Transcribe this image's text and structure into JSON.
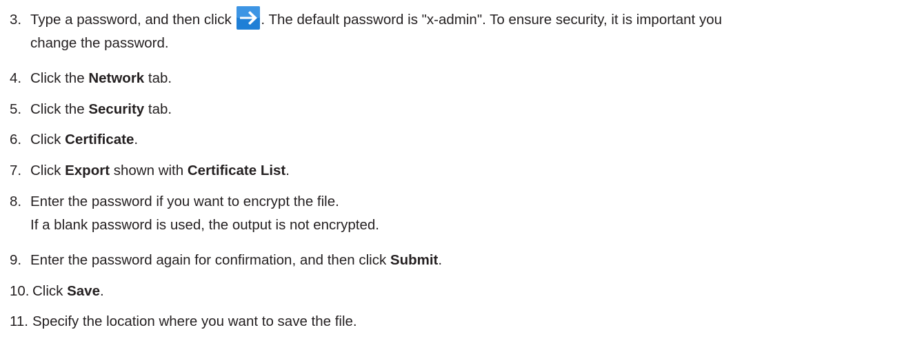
{
  "steps": {
    "s3": {
      "num": "3.",
      "line1_before": "Type a password, and then click",
      "icon": "arrow-right-icon",
      "line1_after": ". The default password is \"x-admin\". To ensure security, it is important you",
      "line2": "change the password."
    },
    "s4": {
      "num": "4.",
      "before": "Click the ",
      "bold": "Network",
      "after": " tab."
    },
    "s5": {
      "num": "5.",
      "before": "Click the ",
      "bold": "Security",
      "after": " tab."
    },
    "s6": {
      "num": "6.",
      "before": "Click ",
      "bold": "Certificate",
      "after": "."
    },
    "s7": {
      "num": "7.",
      "before": "Click ",
      "bold1": "Export",
      "middle": " shown with ",
      "bold2": "Certificate List",
      "after": "."
    },
    "s8": {
      "num": "8.",
      "line1": "Enter the password if you want to encrypt the file.",
      "line2": "If a blank password is used, the output is not encrypted."
    },
    "s9": {
      "num": "9.",
      "before": "Enter the password again for confirmation, and then click ",
      "bold": "Submit",
      "after": "."
    },
    "s10": {
      "num": "10.",
      "before": "Click ",
      "bold": "Save",
      "after": "."
    },
    "s11": {
      "num": "11.",
      "text": "Specify the location where you want to save the file."
    }
  },
  "colors": {
    "text": "#231f20",
    "icon_fill": "#1f7fd6",
    "icon_arrow": "#ffffff"
  }
}
